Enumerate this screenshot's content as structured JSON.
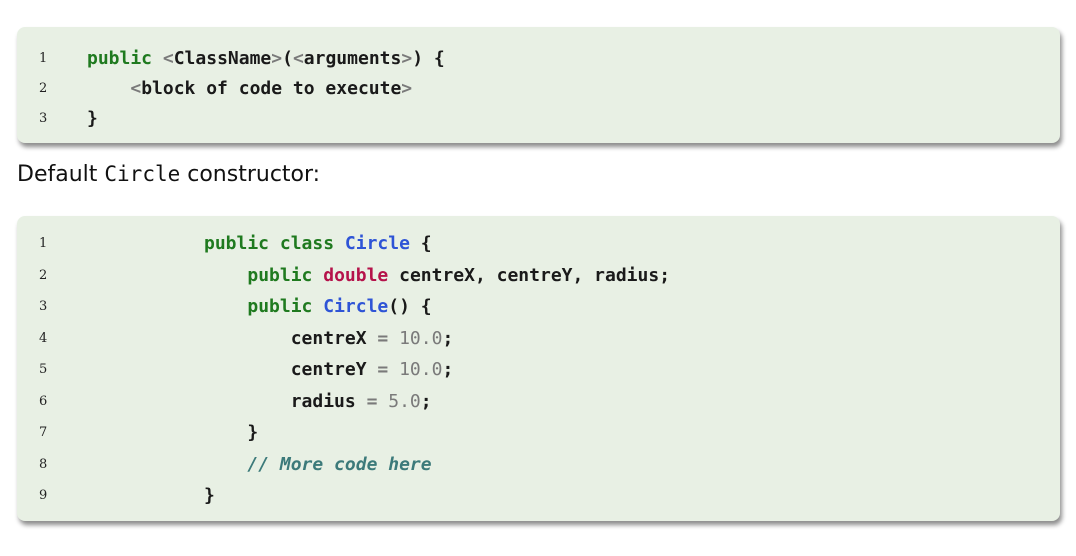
{
  "template_block": {
    "lines": [
      {
        "num": "1",
        "indent": "",
        "parts": [
          {
            "t": "public",
            "c": "kw"
          },
          {
            "t": " ",
            "c": ""
          },
          {
            "t": "<",
            "c": "op"
          },
          {
            "t": "ClassName",
            "c": ""
          },
          {
            "t": ">",
            "c": "op"
          },
          {
            "t": "(",
            "c": ""
          },
          {
            "t": "<",
            "c": "op"
          },
          {
            "t": "arguments",
            "c": ""
          },
          {
            "t": ">",
            "c": "op"
          },
          {
            "t": ") {",
            "c": ""
          }
        ]
      },
      {
        "num": "2",
        "indent": "    ",
        "parts": [
          {
            "t": "<",
            "c": "op"
          },
          {
            "t": "block of code to execute",
            "c": ""
          },
          {
            "t": ">",
            "c": "op"
          }
        ]
      },
      {
        "num": "3",
        "indent": "",
        "parts": [
          {
            "t": "}",
            "c": ""
          }
        ]
      }
    ]
  },
  "caption": {
    "prefix": "Default ",
    "code": "Circle",
    "suffix": " constructor:"
  },
  "circle_block": {
    "lines": [
      {
        "num": "1",
        "indent": "",
        "parts": [
          {
            "t": "public",
            "c": "kw"
          },
          {
            "t": " ",
            "c": ""
          },
          {
            "t": "class",
            "c": "kw"
          },
          {
            "t": " ",
            "c": ""
          },
          {
            "t": "Circle",
            "c": "cls"
          },
          {
            "t": " {",
            "c": ""
          }
        ]
      },
      {
        "num": "2",
        "indent": "    ",
        "parts": [
          {
            "t": "public",
            "c": "kw"
          },
          {
            "t": " ",
            "c": ""
          },
          {
            "t": "double",
            "c": "ty"
          },
          {
            "t": " centreX, centreY, radius;",
            "c": ""
          }
        ]
      },
      {
        "num": "3",
        "indent": "    ",
        "parts": [
          {
            "t": "public",
            "c": "kw"
          },
          {
            "t": " ",
            "c": ""
          },
          {
            "t": "Circle",
            "c": "cls"
          },
          {
            "t": "() {",
            "c": ""
          }
        ]
      },
      {
        "num": "4",
        "indent": "        ",
        "parts": [
          {
            "t": "centreX",
            "c": ""
          },
          {
            "t": " = ",
            "c": "op"
          },
          {
            "t": "10.0",
            "c": "num"
          },
          {
            "t": ";",
            "c": ""
          }
        ]
      },
      {
        "num": "5",
        "indent": "        ",
        "parts": [
          {
            "t": "centreY",
            "c": ""
          },
          {
            "t": " = ",
            "c": "op"
          },
          {
            "t": "10.0",
            "c": "num"
          },
          {
            "t": ";",
            "c": ""
          }
        ]
      },
      {
        "num": "6",
        "indent": "        ",
        "parts": [
          {
            "t": "radius",
            "c": ""
          },
          {
            "t": " = ",
            "c": "op"
          },
          {
            "t": "5.0",
            "c": "num"
          },
          {
            "t": ";",
            "c": ""
          }
        ]
      },
      {
        "num": "7",
        "indent": "    ",
        "parts": [
          {
            "t": "}",
            "c": ""
          }
        ]
      },
      {
        "num": "8",
        "indent": "    ",
        "parts": [
          {
            "t": "// More code here",
            "c": "com"
          }
        ]
      },
      {
        "num": "9",
        "indent": "",
        "parts": [
          {
            "t": "}",
            "c": ""
          }
        ]
      }
    ]
  },
  "colors": {
    "code_background": "#e8f0e4",
    "keyword": "#1f7a1f",
    "type": "#b5124a",
    "class_name": "#2e54d6",
    "comment": "#3c7a7a",
    "literal": "#7a7a7a"
  }
}
